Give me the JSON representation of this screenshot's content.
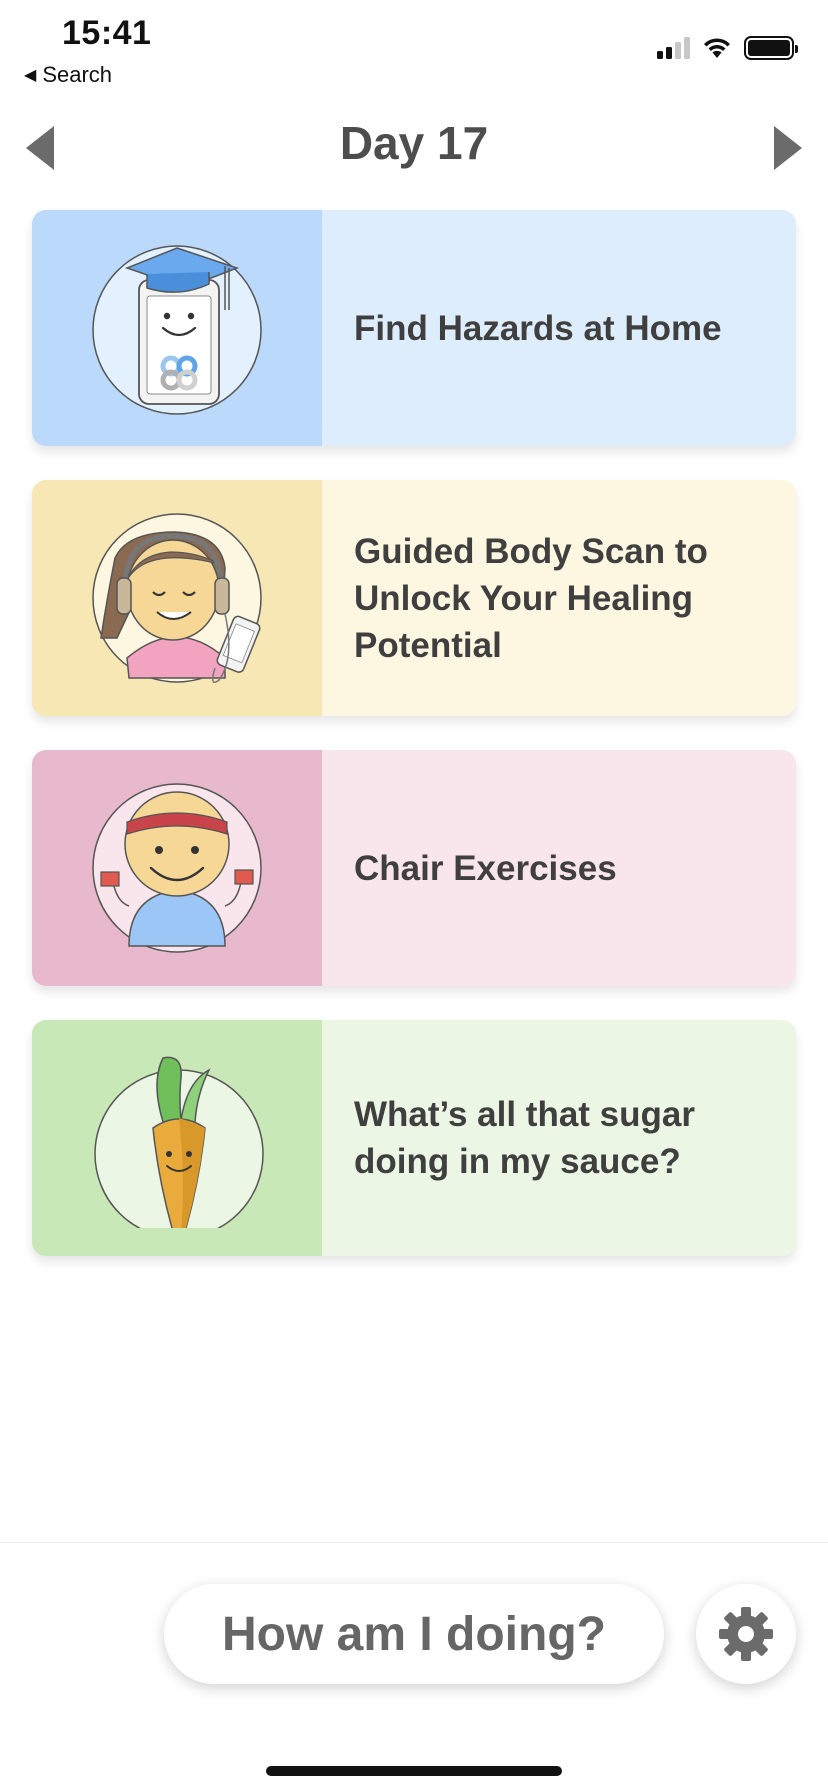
{
  "status_bar": {
    "time": "15:41",
    "back_label": "Search",
    "back_icon": "back-triangle-icon",
    "icons": [
      "cellular-signal-icon",
      "wifi-icon",
      "battery-icon"
    ]
  },
  "header": {
    "title": "Day 17",
    "prev_icon": "triangle-left-icon",
    "next_icon": "triangle-right-icon"
  },
  "cards": [
    {
      "title": "Find Hazards at Home",
      "illustration": "graduate-phone-mascot",
      "colors": {
        "thumb_bg": "#bad9fb",
        "label_bg": "#deedfc"
      }
    },
    {
      "title": "Guided Body Scan to Unlock Your Healing Potential",
      "illustration": "girl-with-headphones",
      "colors": {
        "thumb_bg": "#f6e7b5",
        "label_bg": "#fdf6e0"
      }
    },
    {
      "title": "Chair Exercises",
      "illustration": "man-with-dumbbells",
      "colors": {
        "thumb_bg": "#e8b9cc",
        "label_bg": "#f9e6ec"
      }
    },
    {
      "title": "What’s all that sugar doing in my sauce?",
      "illustration": "smiling-carrot",
      "colors": {
        "thumb_bg": "#c8e8b8",
        "label_bg": "#ebf6e4"
      }
    }
  ],
  "footer": {
    "progress_button_label": "How am I doing?",
    "settings_icon": "gear-icon"
  },
  "colors": {
    "text_primary": "#3f3f3f",
    "arrow_gray": "#6b6b6b",
    "button_text": "#666666"
  }
}
